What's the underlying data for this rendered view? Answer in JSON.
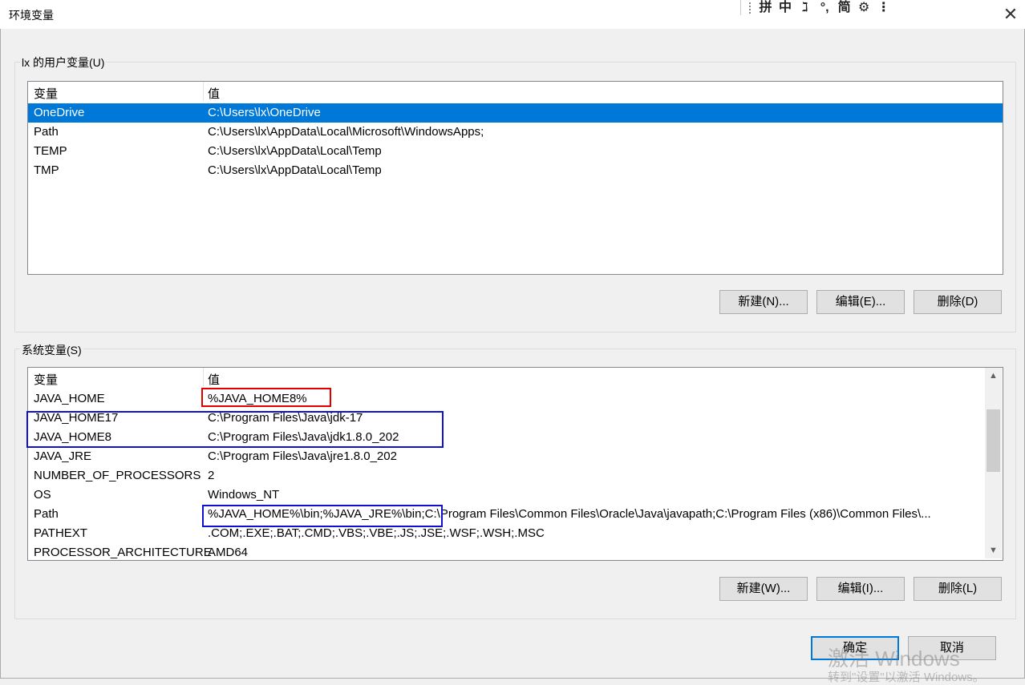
{
  "window": {
    "title": "环境变量"
  },
  "ime": {
    "items": [
      "拼",
      "中",
      "ℷ",
      "°,",
      "简",
      "⚙",
      "⋮"
    ]
  },
  "user_vars": {
    "group_label": "lx 的用户变量(U)",
    "columns": [
      "变量",
      "值"
    ],
    "rows": [
      {
        "name": "OneDrive",
        "value": "C:\\Users\\lx\\OneDrive",
        "selected": true
      },
      {
        "name": "Path",
        "value": "C:\\Users\\lx\\AppData\\Local\\Microsoft\\WindowsApps;"
      },
      {
        "name": "TEMP",
        "value": "C:\\Users\\lx\\AppData\\Local\\Temp"
      },
      {
        "name": "TMP",
        "value": "C:\\Users\\lx\\AppData\\Local\\Temp"
      }
    ],
    "buttons": {
      "new": "新建(N)...",
      "edit": "编辑(E)...",
      "delete": "删除(D)"
    }
  },
  "system_vars": {
    "group_label": "系统变量(S)",
    "columns": [
      "变量",
      "值"
    ],
    "rows": [
      {
        "name": "JAVA_HOME",
        "value": "%JAVA_HOME8%"
      },
      {
        "name": "JAVA_HOME17",
        "value": "C:\\Program Files\\Java\\jdk-17"
      },
      {
        "name": "JAVA_HOME8",
        "value": "C:\\Program Files\\Java\\jdk1.8.0_202"
      },
      {
        "name": "JAVA_JRE",
        "value": "C:\\Program Files\\Java\\jre1.8.0_202"
      },
      {
        "name": "NUMBER_OF_PROCESSORS",
        "value": "2"
      },
      {
        "name": "OS",
        "value": "Windows_NT"
      },
      {
        "name": "Path",
        "value": "%JAVA_HOME%\\bin;%JAVA_JRE%\\bin;C:\\Program Files\\Common Files\\Oracle\\Java\\javapath;C:\\Program Files (x86)\\Common Files\\..."
      },
      {
        "name": "PATHEXT",
        "value": ".COM;.EXE;.BAT;.CMD;.VBS;.VBE;.JS;.JSE;.WSF;.WSH;.MSC"
      },
      {
        "name": "PROCESSOR_ARCHITECTURE",
        "value": "AMD64"
      }
    ],
    "buttons": {
      "new": "新建(W)...",
      "edit": "编辑(I)...",
      "delete": "删除(L)"
    }
  },
  "dialog_buttons": {
    "ok": "确定",
    "cancel": "取消"
  },
  "watermark": {
    "line1": "激活 Windows",
    "line2": "转到\"设置\"以激活 Windows。"
  },
  "colors": {
    "selection": "#0078d7",
    "highlight_red": "#e00000",
    "highlight_blue": "#1010d0"
  }
}
